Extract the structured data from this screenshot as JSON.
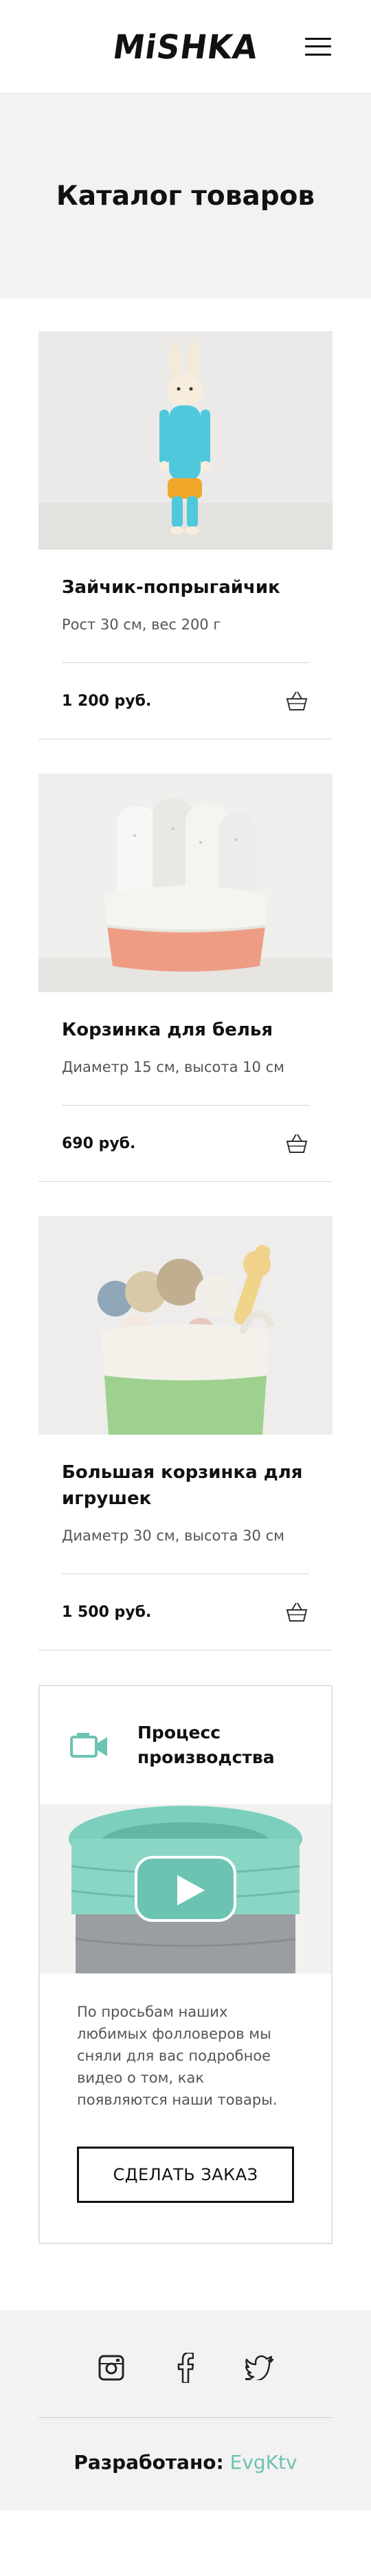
{
  "header": {
    "logo": "MiSHKA",
    "menu_icon": "hamburger-icon"
  },
  "page": {
    "title": "Каталог товаров"
  },
  "products": [
    {
      "name": "Зайчик-попрыгайчик",
      "desc": "Рост 30 см, вес 200 г",
      "price": "1 200 руб.",
      "image": "knitted-bunny-photo",
      "cart_icon": "basket-icon"
    },
    {
      "name": "Корзинка для белья",
      "desc": "Диаметр 15 см, высота 10 см",
      "price": "690 руб.",
      "image": "laundry-basket-photo",
      "cart_icon": "basket-icon"
    },
    {
      "name": "Большая корзинка для игрушек",
      "desc": "Диаметр 30 см, высота 30 см",
      "price": "1 500 руб.",
      "image": "toy-basket-photo",
      "cart_icon": "basket-icon"
    }
  ],
  "video": {
    "icon": "video-camera-icon",
    "title": "Процесс производства",
    "image": "crochet-basket-photo",
    "play_icon": "play-icon",
    "text": "По просьбам наших любимых фолловеров мы сняли для вас подробное видео о том, как появляются наши товары.",
    "button": "СДЕЛАТЬ ЗАКАЗ"
  },
  "footer": {
    "social": [
      "instagram-icon",
      "facebook-icon",
      "twitter-icon"
    ],
    "dev_label": "Разработано:",
    "dev_name": "EvgKtv"
  },
  "colors": {
    "accent": "#6cc3b2",
    "band": "#f2f2f2",
    "text": "#111111"
  }
}
